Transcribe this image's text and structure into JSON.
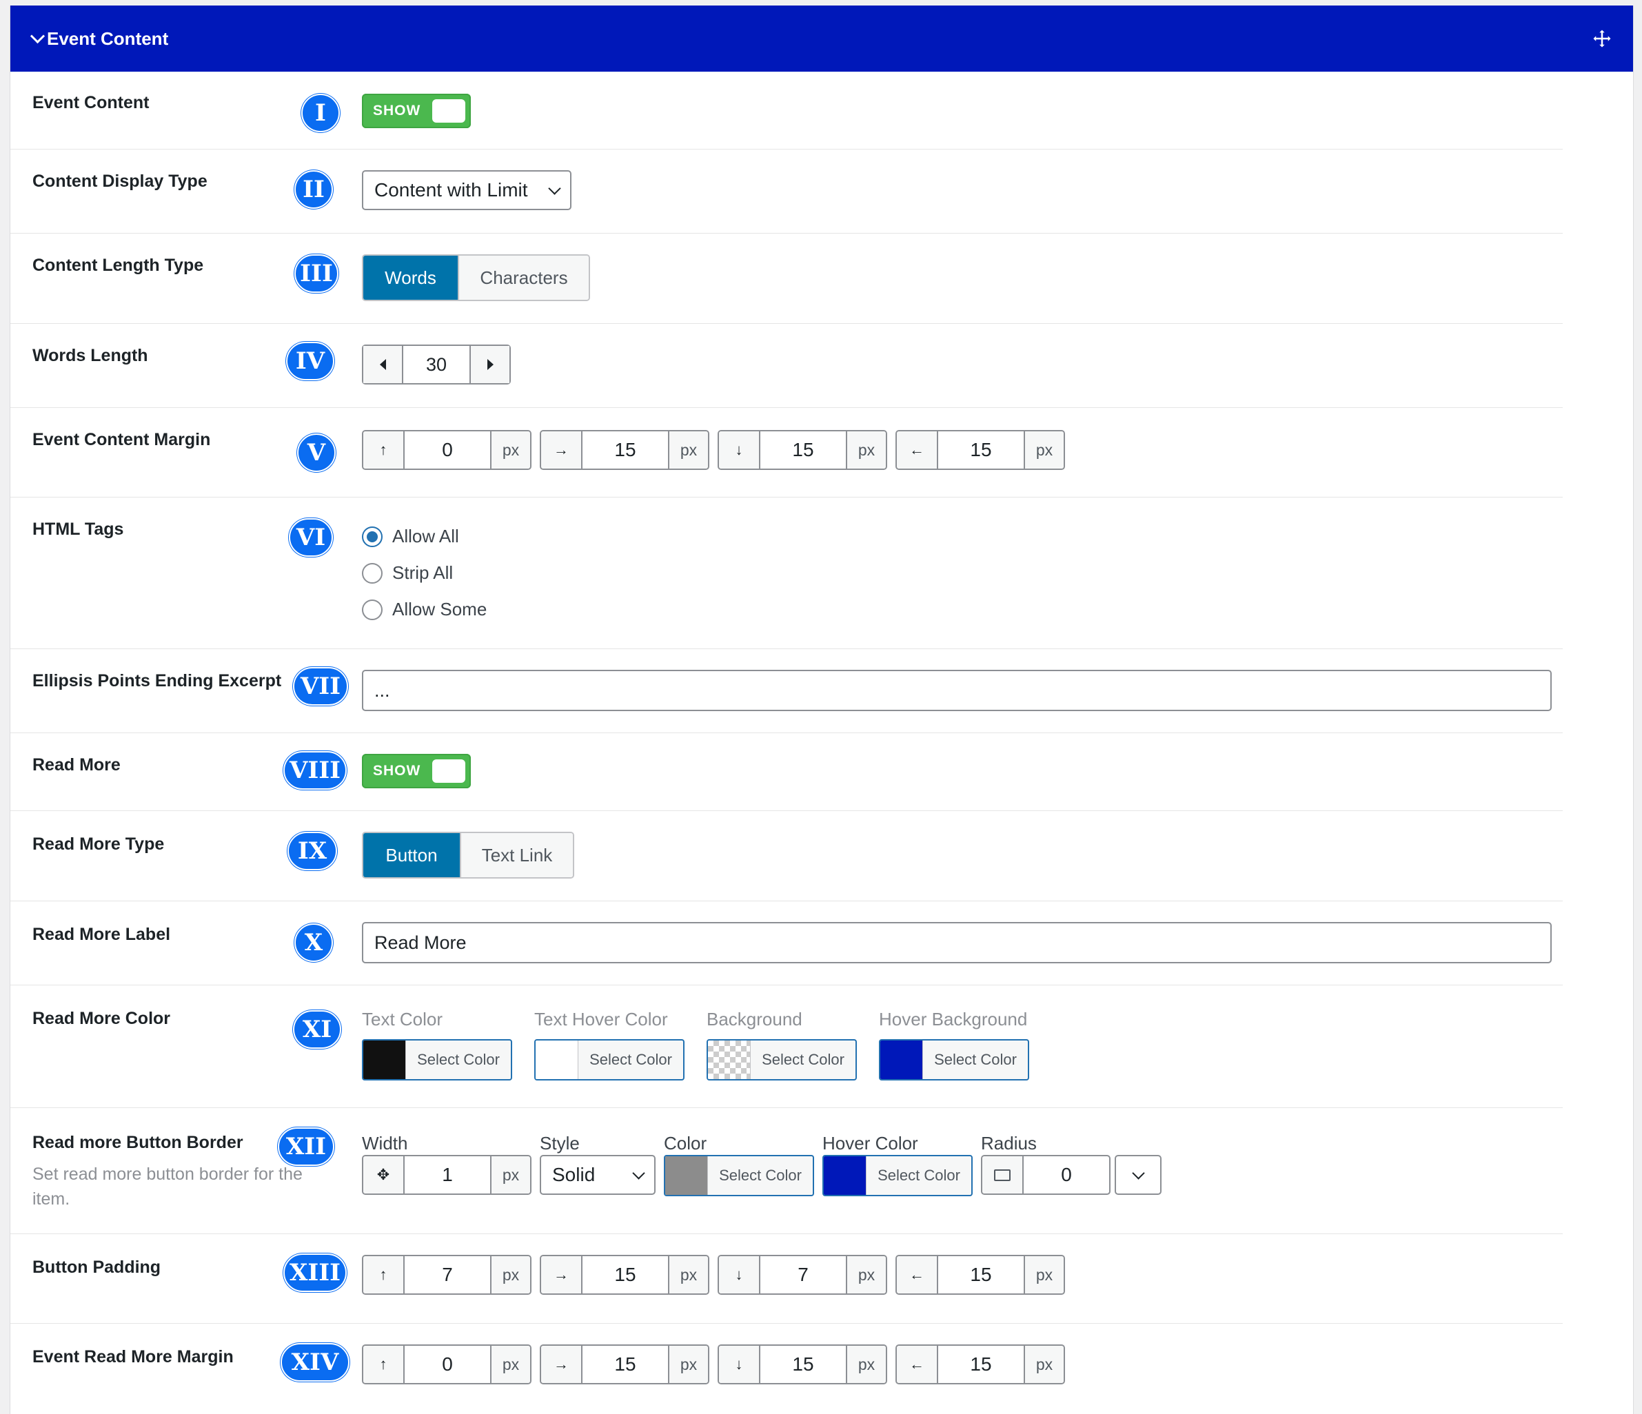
{
  "header": {
    "title": "Event Content"
  },
  "colors": {
    "header_bg": "#0018b9",
    "badge": "#0a6cf1",
    "toggle_on": "#4bb84e",
    "active_btn": "#0073aa"
  },
  "rows": {
    "event_content": {
      "label": "Event Content",
      "badge": "I",
      "toggle": "SHOW"
    },
    "display_type": {
      "label": "Content Display Type",
      "badge": "II",
      "value": "Content with Limit"
    },
    "length_type": {
      "label": "Content Length Type",
      "badge": "III",
      "options": [
        "Words",
        "Characters"
      ],
      "selected": "Words"
    },
    "words_length": {
      "label": "Words Length",
      "badge": "IV",
      "value": "30"
    },
    "content_margin": {
      "label": "Event Content Margin",
      "badge": "V",
      "top": "0",
      "right": "15",
      "bottom": "15",
      "left": "15",
      "unit": "px"
    },
    "html_tags": {
      "label": "HTML Tags",
      "badge": "VI",
      "options": [
        "Allow All",
        "Strip All",
        "Allow Some"
      ],
      "selected": "Allow All"
    },
    "ellipsis": {
      "label": "Ellipsis Points Ending Excerpt",
      "badge": "VII",
      "value": "..."
    },
    "read_more": {
      "label": "Read More",
      "badge": "VIII",
      "toggle": "SHOW"
    },
    "read_more_type": {
      "label": "Read More Type",
      "badge": "IX",
      "options": [
        "Button",
        "Text Link"
      ],
      "selected": "Button"
    },
    "read_more_label": {
      "label": "Read More Label",
      "badge": "X",
      "value": "Read More"
    },
    "read_more_color": {
      "label": "Read More Color",
      "badge": "XI",
      "pickers": [
        {
          "title": "Text Color",
          "button": "Select Color",
          "swatch": "#111111"
        },
        {
          "title": "Text Hover Color",
          "button": "Select Color",
          "swatch": "#ffffff"
        },
        {
          "title": "Background",
          "button": "Select Color",
          "swatch": "transparent"
        },
        {
          "title": "Hover Background",
          "button": "Select Color",
          "swatch": "#0018b9"
        }
      ]
    },
    "button_border": {
      "label": "Read more Button Border",
      "badge": "XII",
      "description": "Set read more button border for the item.",
      "width_label": "Width",
      "width_value": "1",
      "unit": "px",
      "style_label": "Style",
      "style_value": "Solid",
      "color_label": "Color",
      "color_button": "Select Color",
      "color_swatch": "#8c8c8c",
      "hover_label": "Hover Color",
      "hover_button": "Select Color",
      "hover_swatch": "#0018b9",
      "radius_label": "Radius",
      "radius_value": "0"
    },
    "button_padding": {
      "label": "Button Padding",
      "badge": "XIII",
      "top": "7",
      "right": "15",
      "bottom": "7",
      "left": "15",
      "unit": "px"
    },
    "read_more_margin": {
      "label": "Event Read More Margin",
      "badge": "XIV",
      "top": "0",
      "right": "15",
      "bottom": "15",
      "left": "15",
      "unit": "px"
    }
  }
}
